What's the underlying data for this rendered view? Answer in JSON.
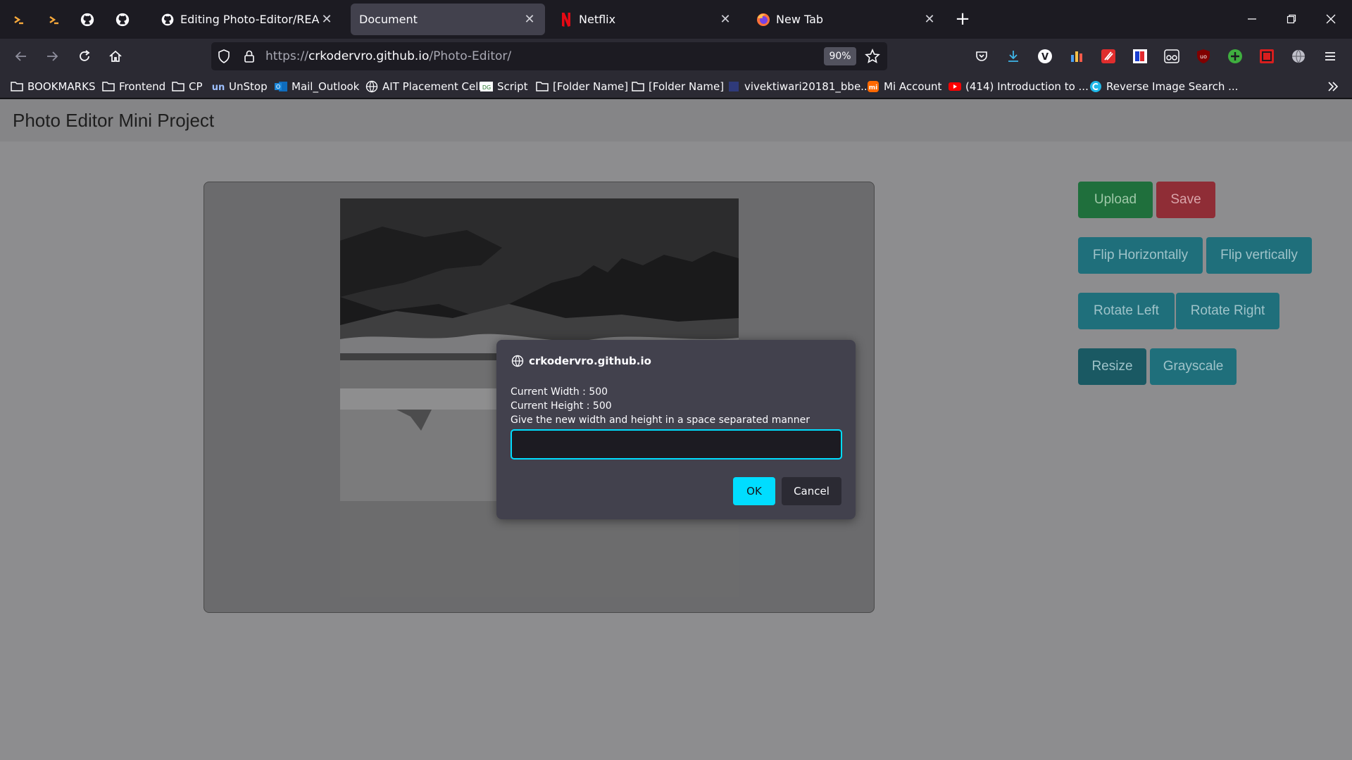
{
  "tabs": [
    {
      "title": "Editing Photo-Editor/README.m",
      "active": false,
      "icon": "github-icon"
    },
    {
      "title": "Document",
      "active": true,
      "icon": ""
    },
    {
      "title": "Netflix",
      "active": false,
      "icon": "netflix-icon"
    },
    {
      "title": "New Tab",
      "active": false,
      "icon": "firefox-icon"
    }
  ],
  "addressbar": {
    "url_scheme": "https://",
    "url_host": "crkodervro.github.io",
    "url_path": "/Photo-Editor/",
    "zoom": "90%"
  },
  "bookmarks": [
    {
      "label": "BOOKMARKS",
      "icon": "folder-icon"
    },
    {
      "label": "Frontend",
      "icon": "folder-icon"
    },
    {
      "label": "CP",
      "icon": "folder-icon"
    },
    {
      "label": "UnStop",
      "icon": "unstop-icon"
    },
    {
      "label": "Mail_Outlook",
      "icon": "outlook-icon"
    },
    {
      "label": "AIT Placement Cell",
      "icon": "globe-icon"
    },
    {
      "label": "Script",
      "icon": "script-icon"
    },
    {
      "label": "[Folder Name]",
      "icon": "folder-icon"
    },
    {
      "label": "[Folder Name]",
      "icon": "folder-icon"
    },
    {
      "label": "vivektiwari20181_bbe...",
      "icon": "site-icon"
    },
    {
      "label": "Mi Account",
      "icon": "mi-icon"
    },
    {
      "label": "(414) Introduction to ...",
      "icon": "youtube-icon"
    },
    {
      "label": "Reverse Image Search ...",
      "icon": "search-site-icon"
    }
  ],
  "page": {
    "title": "Photo Editor Mini Project",
    "buttons": {
      "upload": "Upload",
      "save": "Save",
      "flip_h": "Flip Horizontally",
      "flip_v": "Flip vertically",
      "rotate_left": "Rotate Left",
      "rotate_right": "Rotate Right",
      "resize": "Resize",
      "grayscale": "Grayscale"
    }
  },
  "dialog": {
    "origin": "crkodervro.github.io",
    "line1": "Current Width : 500",
    "line2": "Current Height : 500",
    "line3": "Give the new width and height in a space separated manner",
    "input_value": "",
    "ok": "OK",
    "cancel": "Cancel"
  },
  "colors": {
    "accent": "#00ddff",
    "upload": "#1f6f3c",
    "save": "#8f2d36",
    "teal": "#1f6f7b"
  }
}
